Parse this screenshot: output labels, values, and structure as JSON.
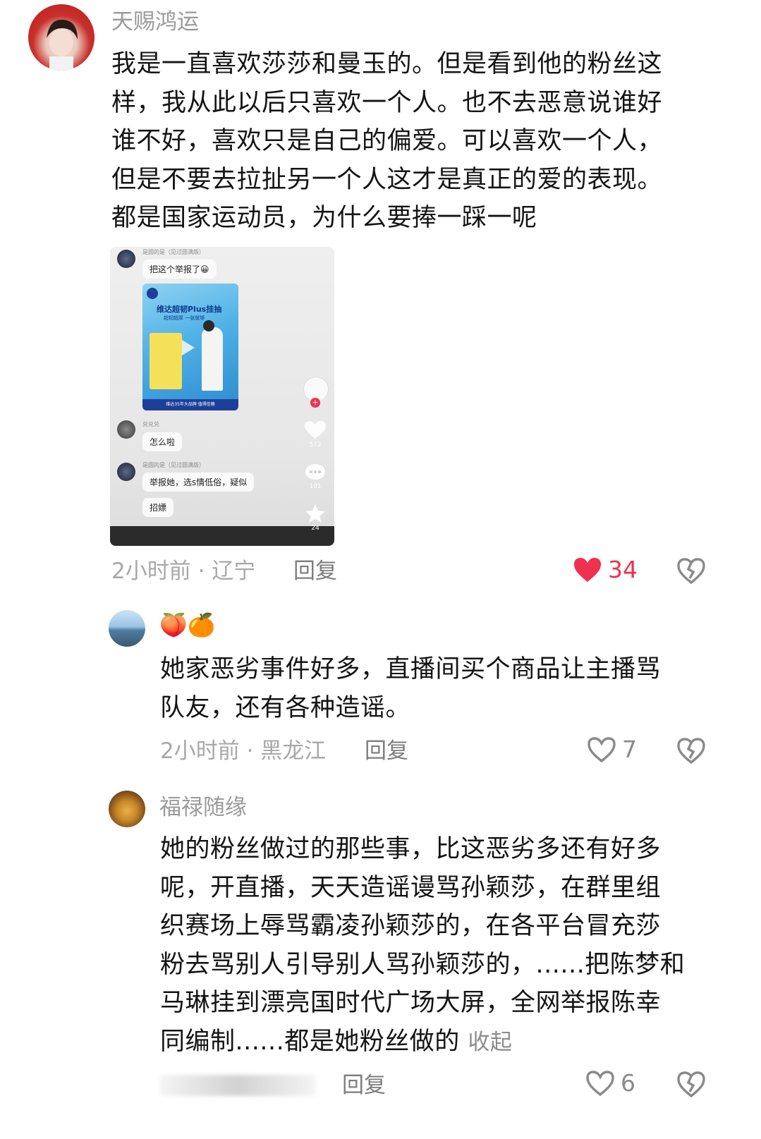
{
  "comments": [
    {
      "username": "天赐鸿运",
      "text_lines": [
        "我是一直喜欢莎莎和曼玉的。但是看到他的粉丝这",
        "样，我从此以后只喜欢一个人。也不去恶意说谁好",
        "谁不好，喜欢只是自己的偏爱。可以喜欢一个人，",
        "但是不要去拉扯另一个人这才是真正的爱的表现。",
        "都是国家运动员，为什么要捧一踩一呢"
      ],
      "meta": "2小时前 · 辽宁",
      "reply_label": "回复",
      "like_count": "34",
      "liked": true,
      "attached_screenshot": {
        "comment1": {
          "name": "是圆的是（见过圆满版）",
          "text": "把这个举报了😀"
        },
        "poster": {
          "title": "维达超韧Plus挂抽",
          "subtitle": "超韧超厚 一张就够",
          "footer": "维达35年大品牌 值得信赖"
        },
        "comment2": {
          "name": "兑兑兑",
          "text": "怎么啦"
        },
        "comment3": {
          "name": "是圆的是（见过圆满版）",
          "line1": "举报她，选s情低俗，疑似",
          "line2": "招嫖"
        },
        "side_counts": {
          "likes": "572",
          "comments": "101",
          "favorites": "24"
        }
      }
    },
    {
      "username_emoji": "🍑🍊",
      "text_lines": [
        "她家恶劣事件好多，直播间买个商品让主播骂",
        "队友，还有各种造谣。"
      ],
      "meta": "2小时前 · 黑龙江",
      "reply_label": "回复",
      "like_count": "7",
      "liked": false
    },
    {
      "username": "福禄随缘",
      "text_lines": [
        "她的粉丝做过的那些事，比这恶劣多还有好多",
        "呢，开直播，天天造谣谩骂孙颖莎，在群里组",
        "织赛场上辱骂霸凌孙颖莎的，在各平台冒充莎",
        "粉去骂别人引导别人骂孙颖莎的，......把陈梦和",
        "马琳挂到漂亮国时代广场大屏，全网举报陈幸",
        "同编制......都是她粉丝做的"
      ],
      "collapse_label": "收起",
      "reply_label": "回复",
      "like_count": "6",
      "liked": false
    }
  ],
  "colors": {
    "like_active": "#f0304f",
    "meta_gray": "#a8a8a8",
    "text": "#141414"
  }
}
